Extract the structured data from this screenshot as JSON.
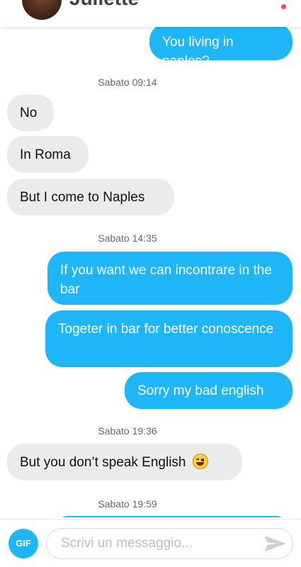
{
  "header": {
    "contact_name": "Juliette",
    "menu_icon": "more-vertical-icon",
    "accent_color": "#ff4458"
  },
  "messages": [
    {
      "direction": "out",
      "text": "You living in naples?"
    },
    {
      "direction": "in",
      "text": "No"
    },
    {
      "direction": "in",
      "text": "In Roma"
    },
    {
      "direction": "in",
      "text": "But I come to Naples"
    },
    {
      "direction": "out",
      "text": "If you want we can incontrare in the bar"
    },
    {
      "direction": "out",
      "text": "Togeter in bar for better conoscence"
    },
    {
      "direction": "out",
      "text": "Sorry my bad english"
    },
    {
      "direction": "in",
      "text": "But you don’t speak English",
      "emoji": "laughing-face-icon"
    }
  ],
  "timestamps": [
    "Sabato 09:14",
    "Sabato 14:35",
    "Sabato 19:36",
    "Sabato 19:59"
  ],
  "composer": {
    "gif_label": "GIF",
    "placeholder": "Scrivi un messaggio...",
    "send_icon": "send-icon"
  },
  "colors": {
    "outgoing_bubble": "#1fb6f7",
    "incoming_bubble": "#ebebeb"
  }
}
